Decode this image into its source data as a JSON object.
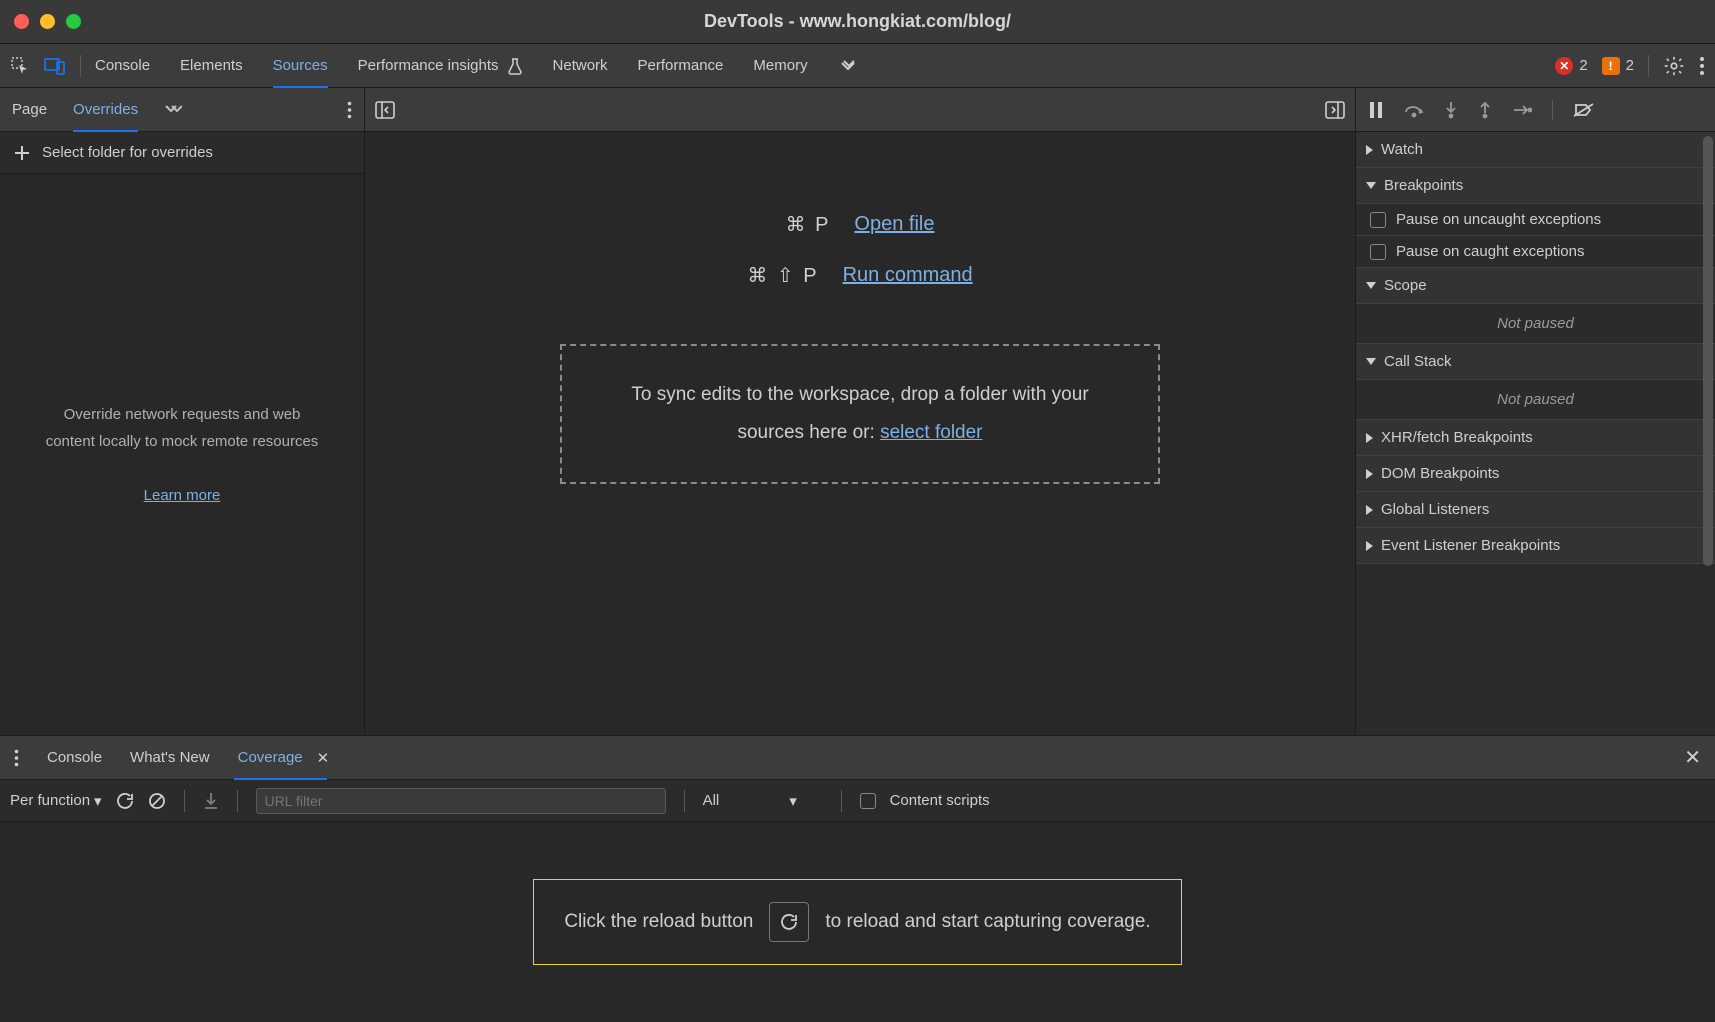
{
  "window": {
    "title": "DevTools - www.hongkiat.com/blog/"
  },
  "main_tabs": {
    "console": "Console",
    "elements": "Elements",
    "sources": "Sources",
    "perf_insights": "Performance insights",
    "network": "Network",
    "performance": "Performance",
    "memory": "Memory"
  },
  "badges": {
    "errors": "2",
    "warnings": "2"
  },
  "left": {
    "tabs": {
      "page": "Page",
      "overrides": "Overrides"
    },
    "add_label": "Select folder for overrides",
    "hint": "Override network requests and web content locally to mock remote resources",
    "learn_more": "Learn more"
  },
  "center": {
    "open_file_keys": "⌘ P",
    "open_file": "Open file",
    "run_cmd_keys": "⌘ ⇧ P",
    "run_cmd": "Run command",
    "drop_prefix": "To sync edits to the workspace, drop a folder with your sources here or: ",
    "select_folder": "select folder"
  },
  "debugger": {
    "watch": "Watch",
    "breakpoints": "Breakpoints",
    "pause_uncaught": "Pause on uncaught exceptions",
    "pause_caught": "Pause on caught exceptions",
    "scope": "Scope",
    "not_paused": "Not paused",
    "call_stack": "Call Stack",
    "xhr": "XHR/fetch Breakpoints",
    "dom": "DOM Breakpoints",
    "global": "Global Listeners",
    "event": "Event Listener Breakpoints"
  },
  "drawer": {
    "tabs": {
      "console": "Console",
      "whatsnew": "What's New",
      "coverage": "Coverage"
    }
  },
  "coverage": {
    "granularity": "Per function",
    "url_placeholder": "URL filter",
    "type_filter": "All",
    "content_scripts": "Content scripts",
    "hint_before": "Click the reload button",
    "hint_after": "to reload and start capturing coverage."
  }
}
